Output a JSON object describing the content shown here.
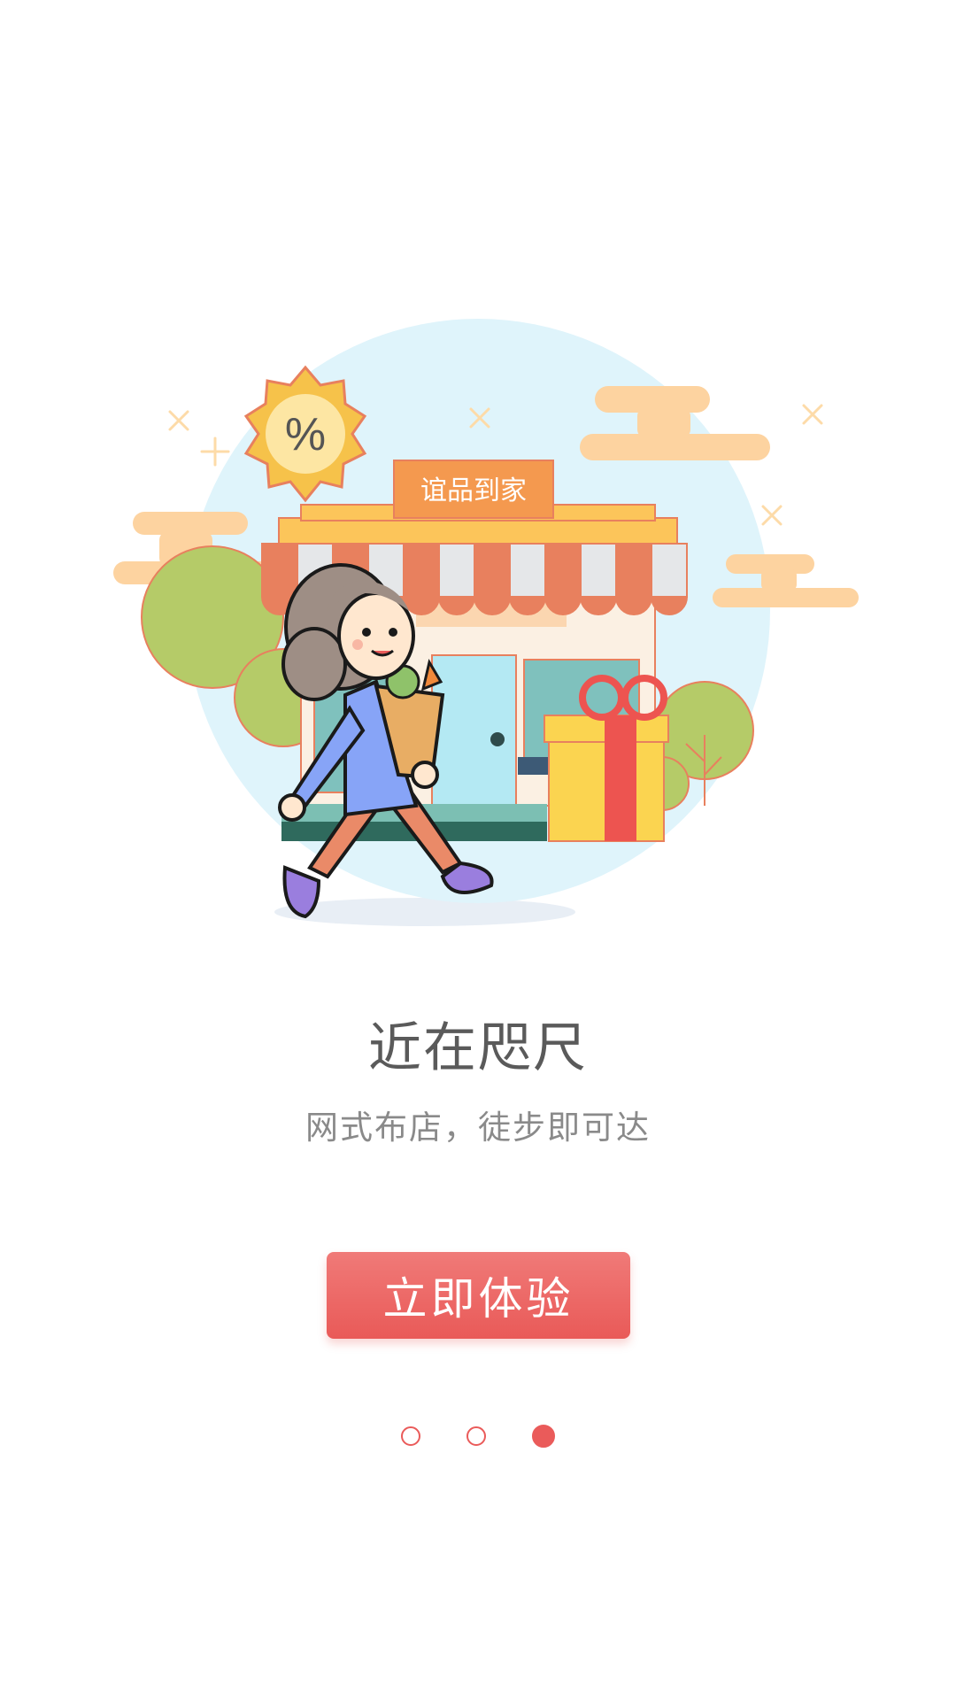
{
  "illustration": {
    "shop_sign": "谊品到家",
    "badge_symbol": "%"
  },
  "onboarding": {
    "title": "近在咫尺",
    "subtitle": "网式布店，徒步即可达",
    "cta_label": "立即体验"
  },
  "pager": {
    "total": 3,
    "active_index": 2
  },
  "colors": {
    "accent": "#ea5b5a",
    "sky": "#dff4fb",
    "awning_orange": "#e8805e",
    "sign_orange": "#f4994f",
    "cloud": "#fdd3a0",
    "tree_green": "#b5cb68"
  }
}
